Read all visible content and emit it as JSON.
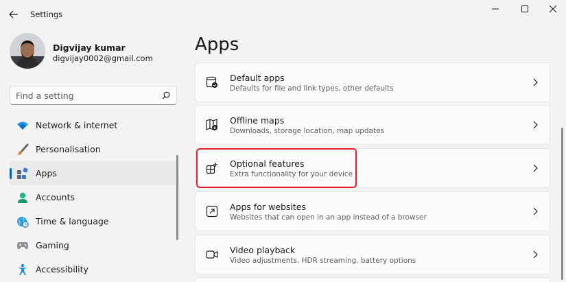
{
  "window": {
    "title": "Settings"
  },
  "user": {
    "name": "Digvijay kumar",
    "email": "digvijay0002@gmail.com"
  },
  "search": {
    "placeholder": "Find a setting"
  },
  "nav": {
    "items": [
      {
        "label": "Network & internet",
        "icon": "wifi-icon"
      },
      {
        "label": "Personalisation",
        "icon": "brush-icon"
      },
      {
        "label": "Apps",
        "icon": "apps-icon",
        "active": true
      },
      {
        "label": "Accounts",
        "icon": "person-icon"
      },
      {
        "label": "Time & language",
        "icon": "globe-clock-icon"
      },
      {
        "label": "Gaming",
        "icon": "gamepad-icon"
      },
      {
        "label": "Accessibility",
        "icon": "accessibility-icon"
      }
    ]
  },
  "main": {
    "title": "Apps",
    "cards": [
      {
        "title": "Default apps",
        "desc": "Defaults for file and link types, other defaults",
        "icon": "default-apps-icon"
      },
      {
        "title": "Offline maps",
        "desc": "Downloads, storage location, map updates",
        "icon": "map-icon"
      },
      {
        "title": "Optional features",
        "desc": "Extra functionality for your device",
        "icon": "optional-features-icon",
        "highlighted": true
      },
      {
        "title": "Apps for websites",
        "desc": "Websites that can open in an app instead of a browser",
        "icon": "open-in-app-icon"
      },
      {
        "title": "Video playback",
        "desc": "Video adjustments, HDR streaming, battery options",
        "icon": "video-icon"
      }
    ]
  },
  "colors": {
    "accent": "#005fb8",
    "highlight": "#e0202b"
  }
}
